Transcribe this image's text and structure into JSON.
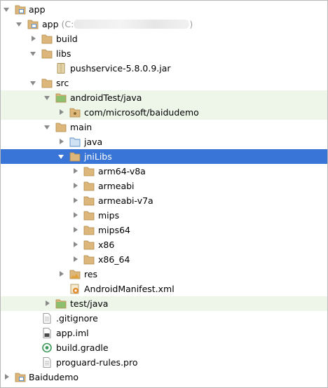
{
  "tree": {
    "root": {
      "label": "app",
      "icon": "module-folder-icon"
    },
    "app_module": {
      "label": "app",
      "path_prefix": "(C:",
      "path_suffix": ")",
      "icon": "module-folder-icon"
    },
    "build": {
      "label": "build",
      "icon": "folder-icon"
    },
    "libs": {
      "label": "libs",
      "icon": "folder-icon"
    },
    "jar": {
      "label": "pushservice-5.8.0.9.jar",
      "icon": "jar-archive-icon"
    },
    "src": {
      "label": "src",
      "icon": "folder-icon"
    },
    "androidTest": {
      "label": "androidTest/java",
      "icon": "test-source-folder-icon"
    },
    "package": {
      "label": "com/microsoft/baidudemo",
      "icon": "package-folder-icon"
    },
    "main": {
      "label": "main",
      "icon": "folder-icon"
    },
    "java": {
      "label": "java",
      "icon": "source-folder-icon"
    },
    "jniLibs": {
      "label": "jniLibs",
      "icon": "folder-icon"
    },
    "abis": [
      {
        "label": "arm64-v8a"
      },
      {
        "label": "armeabi"
      },
      {
        "label": "armeabi-v7a"
      },
      {
        "label": "mips"
      },
      {
        "label": "mips64"
      },
      {
        "label": "x86"
      },
      {
        "label": "x86_64"
      }
    ],
    "res": {
      "label": "res",
      "icon": "resources-folder-icon"
    },
    "manifest": {
      "label": "AndroidManifest.xml",
      "icon": "android-manifest-icon"
    },
    "test": {
      "label": "test/java",
      "icon": "test-source-folder-icon"
    },
    "gitignore": {
      "label": ".gitignore",
      "icon": "text-file-icon"
    },
    "iml": {
      "label": "app.iml",
      "icon": "iml-file-icon"
    },
    "gradle": {
      "label": "build.gradle",
      "icon": "gradle-file-icon"
    },
    "proguard": {
      "label": "proguard-rules.pro",
      "icon": "text-file-icon"
    },
    "baidudemo": {
      "label": "Baidudemo",
      "icon": "module-folder-icon"
    }
  },
  "colors": {
    "selection": "#3875d7",
    "test_row_background": "#eef5e9",
    "folder": "#dcb67a",
    "source_folder": "#6fa8dc",
    "test_folder": "#7fb56f"
  }
}
